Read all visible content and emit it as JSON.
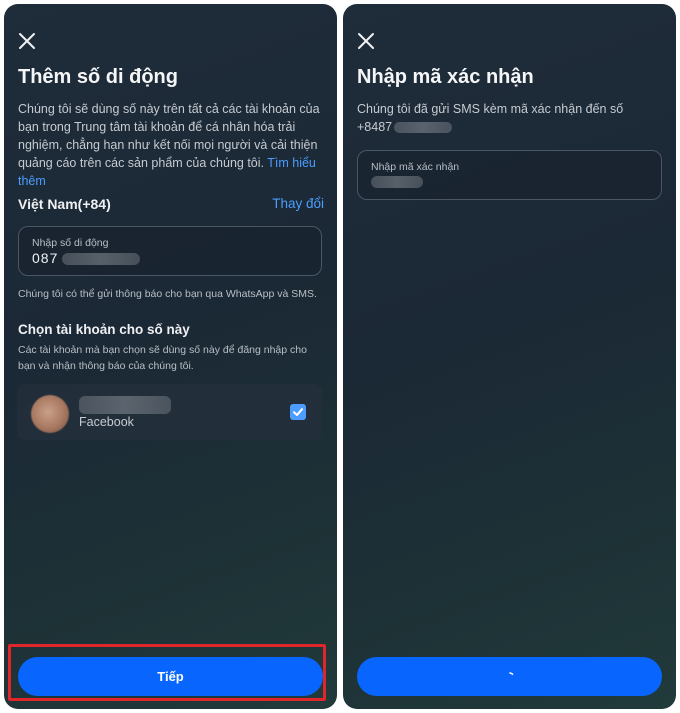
{
  "left": {
    "title": "Thêm số di động",
    "description": "Chúng tôi sẽ dùng số này trên tất cả các tài khoản của bạn trong Trung tâm tài khoản để cá nhân hóa trải nghiệm, chẳng hạn như kết nối mọi người và cải thiện quảng cáo trên các sản phẩm của chúng tôi.",
    "learn_more": "Tìm hiểu thêm",
    "country": "Việt Nam(+84)",
    "change_label": "Thay đổi",
    "phone_field": {
      "label": "Nhập số di động",
      "value_prefix": "087"
    },
    "notice": "Chúng tôi có thể gửi thông báo cho bạn qua WhatsApp và SMS.",
    "choose_title": "Chọn tài khoản cho số này",
    "choose_desc": "Các tài khoản mà bạn chọn sẽ dùng số này để đăng nhập cho bạn và nhận thông báo của chúng tôi.",
    "account": {
      "platform": "Facebook",
      "checked": true
    },
    "next_button": "Tiếp"
  },
  "right": {
    "title": "Nhập mã xác nhận",
    "description": "Chúng tôi đã gửi SMS kèm mã xác nhận đến số",
    "phone_prefix": "+8487",
    "code_field": {
      "label": "Nhập mã xác nhận"
    }
  },
  "colors": {
    "accent": "#0866ff",
    "link": "#4c9dff",
    "highlight": "#e0262a"
  }
}
